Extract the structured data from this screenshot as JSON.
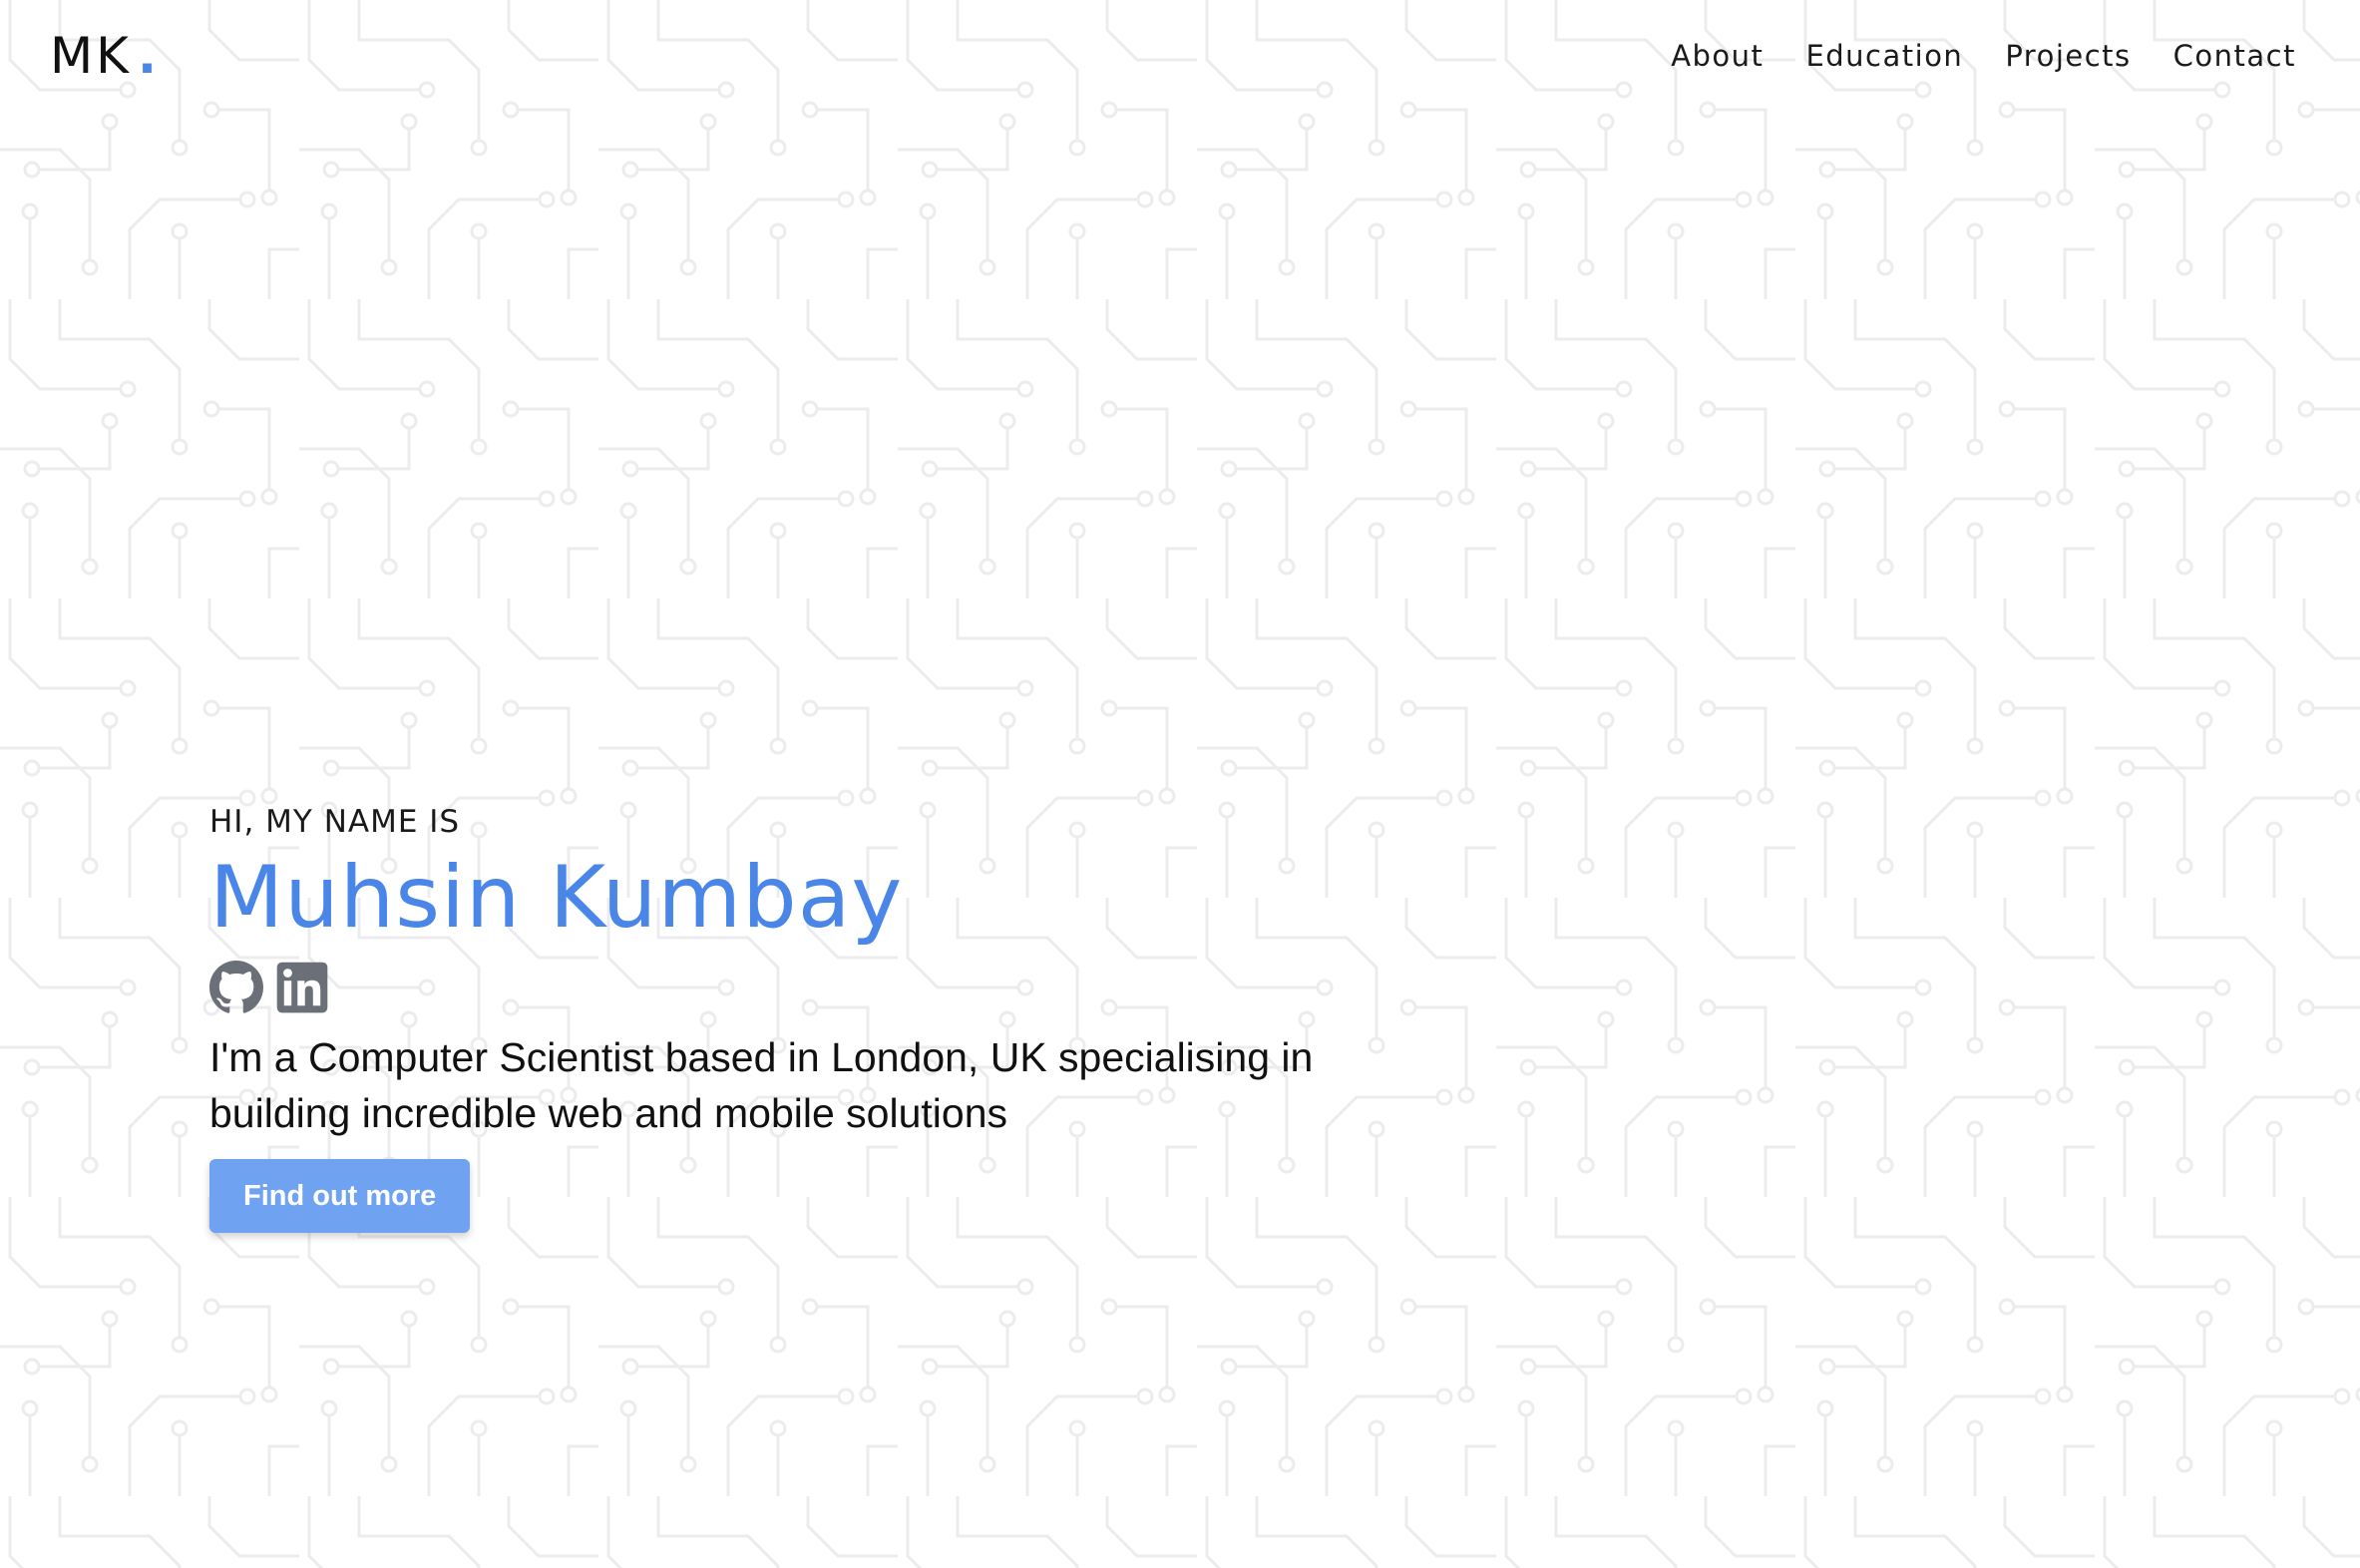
{
  "header": {
    "logo_text": "MK",
    "logo_dot": ".",
    "nav": [
      {
        "label": "About"
      },
      {
        "label": "Education"
      },
      {
        "label": "Projects"
      },
      {
        "label": "Contact"
      }
    ]
  },
  "hero": {
    "greeting": "HI, MY NAME IS",
    "name": "Muhsin Kumbay",
    "socials": [
      {
        "icon": "github-icon"
      },
      {
        "icon": "linkedin-icon"
      }
    ],
    "tagline": "I'm a Computer Scientist based in London, UK specialising in building incredible web and mobile solutions",
    "cta_label": "Find out more"
  },
  "colors": {
    "accent": "#4a86e8",
    "button": "#6fa3f2",
    "icon": "#6b6f77",
    "pattern": "#eeeeef"
  }
}
